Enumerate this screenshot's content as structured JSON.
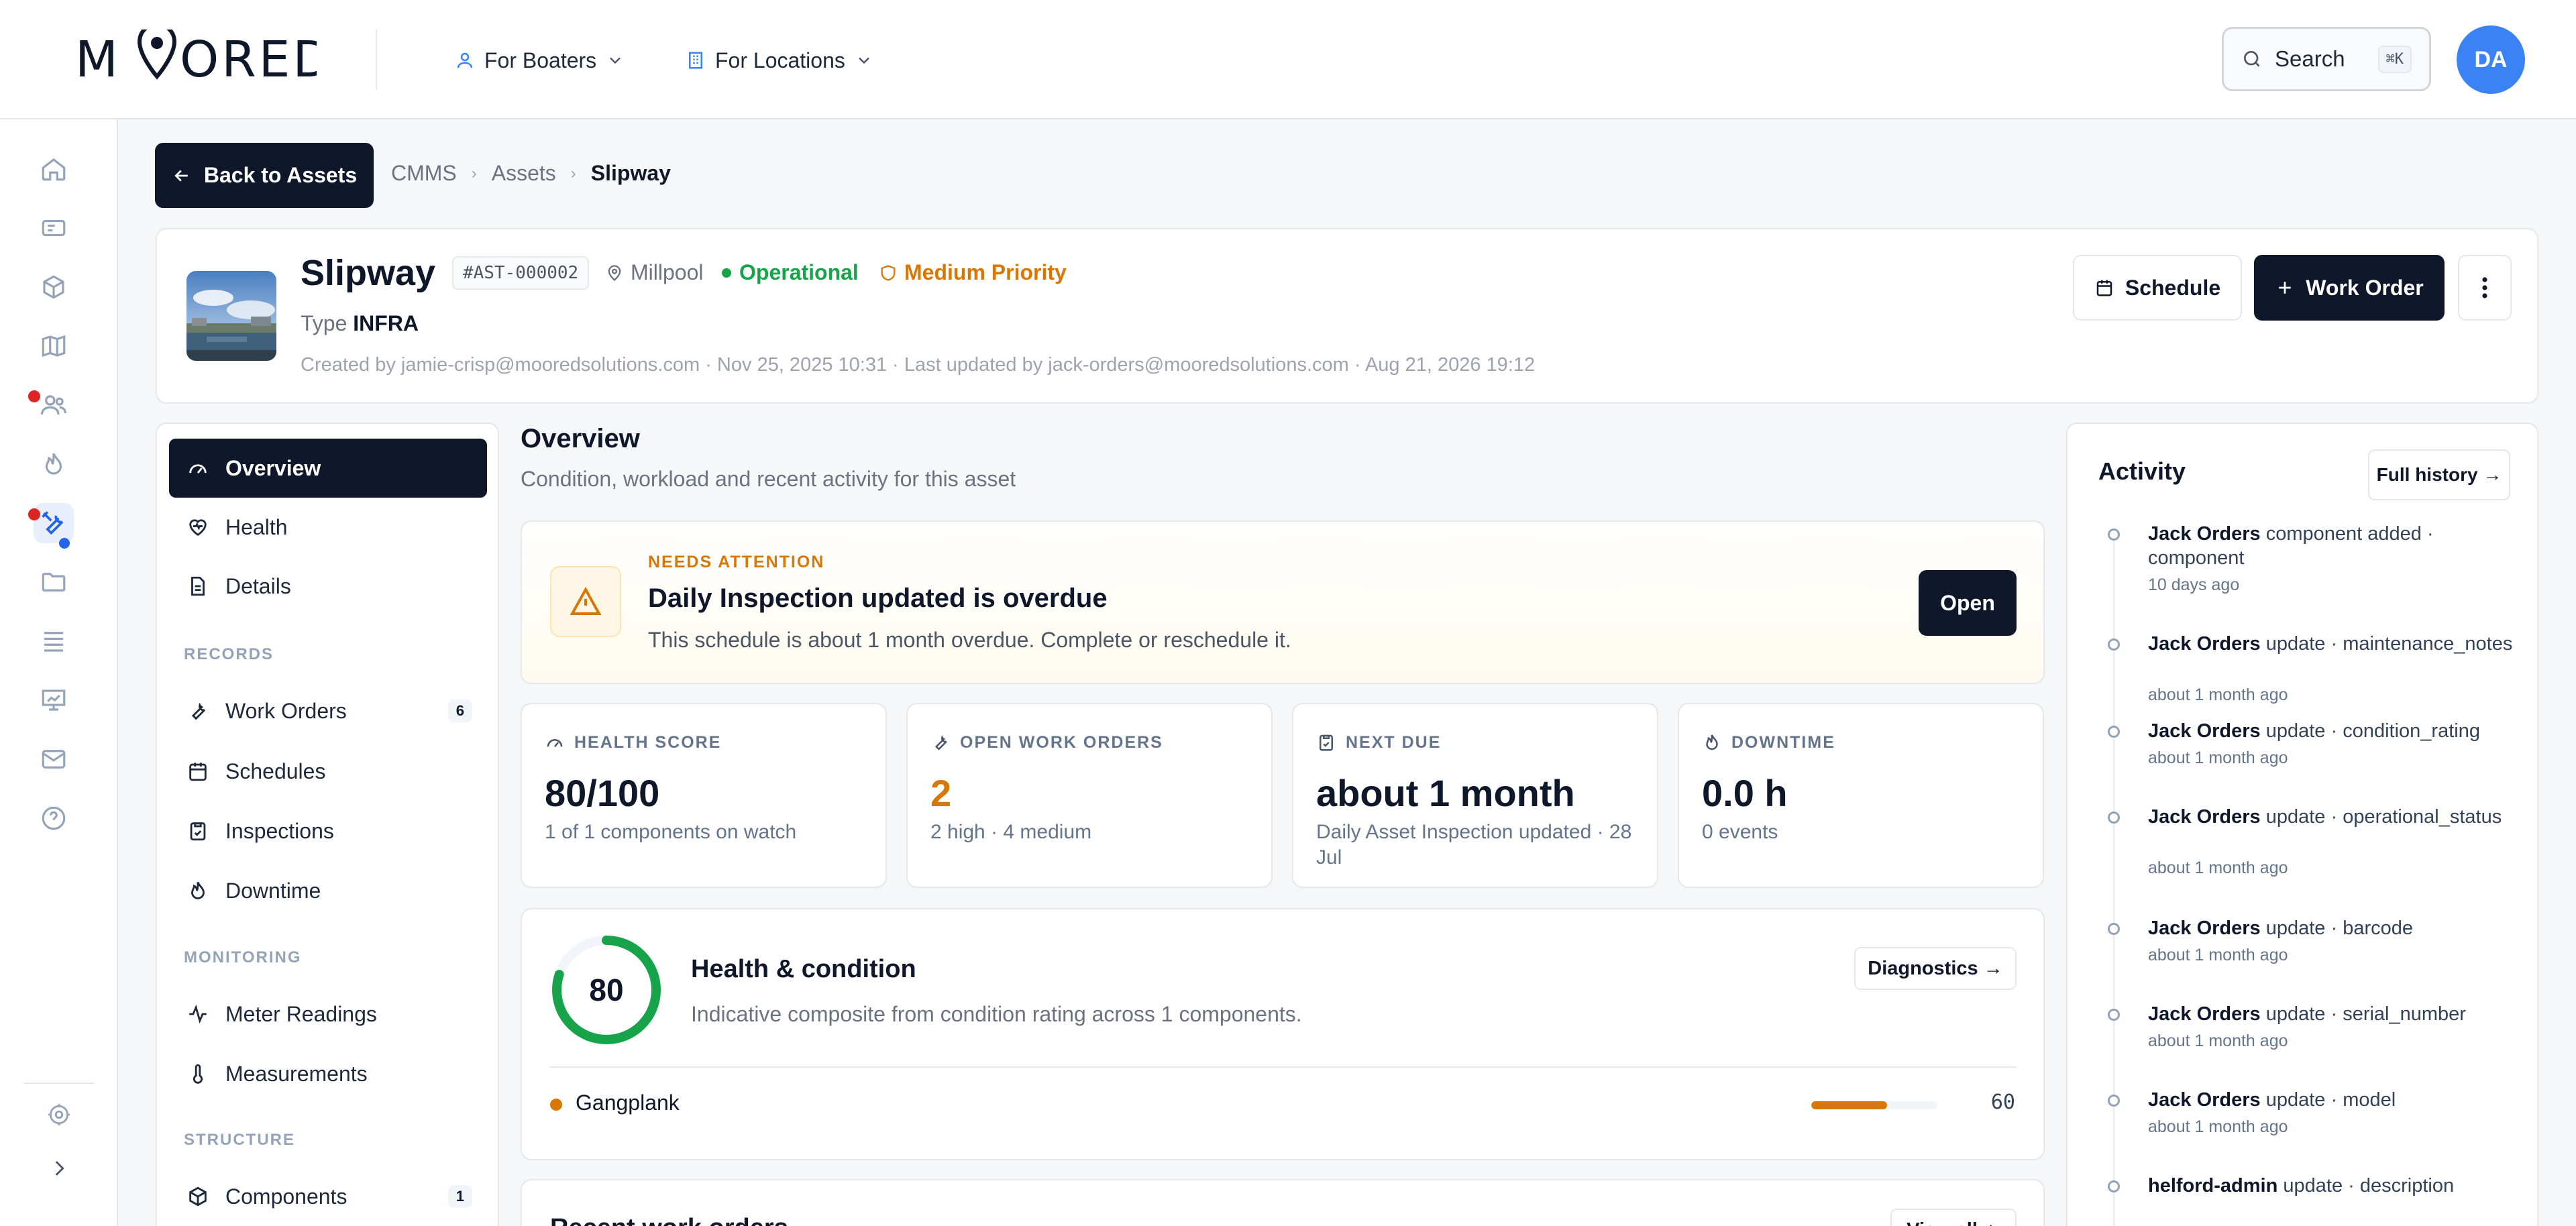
{
  "brand": {
    "logo_text": "MOORED"
  },
  "topnav": {
    "boaters": "For Boaters",
    "locations": "For Locations",
    "search_label": "Search",
    "search_kbd": "⌘K",
    "avatar_initials": "DA"
  },
  "breadcrumb": {
    "back_label": "Back to Assets",
    "items": [
      "CMMS",
      "Assets",
      "Slipway"
    ]
  },
  "asset": {
    "name": "Slipway",
    "id": "#AST-000002",
    "location": "Millpool",
    "status": "Operational",
    "priority": "Medium Priority",
    "type_label": "Type",
    "type_value": "INFRA",
    "meta": "Created by jamie-crisp@mooredsolutions.com · Nov 25, 2025 10:31 · Last updated by jack-orders@mooredsolutions.com · Aug 21, 2026 19:12",
    "schedule_btn": "Schedule",
    "workorder_btn": "Work Order"
  },
  "leftnav": {
    "overview": "Overview",
    "health": "Health",
    "details": "Details",
    "records_head": "RECORDS",
    "work_orders": "Work Orders",
    "work_orders_count": "6",
    "schedules": "Schedules",
    "inspections": "Inspections",
    "downtime": "Downtime",
    "monitoring_head": "MONITORING",
    "meter_readings": "Meter Readings",
    "measurements": "Measurements",
    "structure_head": "STRUCTURE",
    "components": "Components",
    "components_count": "1"
  },
  "overview": {
    "title": "Overview",
    "subtitle": "Condition, workload and recent activity for this asset"
  },
  "alert": {
    "kicker": "NEEDS ATTENTION",
    "title": "Daily Inspection updated is overdue",
    "text": "This schedule is about 1 month overdue. Complete or reschedule it.",
    "button": "Open"
  },
  "kpis": {
    "health": {
      "label": "HEALTH SCORE",
      "value": "80/100",
      "sub": "1 of 1 components on watch"
    },
    "open_wo": {
      "label": "OPEN WORK ORDERS",
      "value": "2",
      "sub": "2 high · 4 medium"
    },
    "next_due": {
      "label": "NEXT DUE",
      "value": "about 1 month",
      "sub": "Daily Asset Inspection updated · 28 Jul"
    },
    "downtime": {
      "label": "DOWNTIME",
      "value": "0.0 h",
      "sub": "0 events"
    }
  },
  "health": {
    "score": "80",
    "score_fraction": 0.8,
    "title": "Health & condition",
    "subtitle": "Indicative composite from condition rating across 1 components.",
    "diag_btn": "Diagnostics →",
    "component_name": "Gangplank",
    "component_value": "60",
    "component_fraction": 0.6
  },
  "recent": {
    "title": "Recent work orders",
    "view_all": "View all"
  },
  "activity": {
    "title": "Activity",
    "full_history": "Full history →",
    "items": [
      {
        "actor": "Jack Orders",
        "action": "component added · component",
        "time": "10 days ago"
      },
      {
        "actor": "Jack Orders",
        "action": "update · maintenance_notes",
        "time": "about 1 month ago"
      },
      {
        "actor": "Jack Orders",
        "action": "update · condition_rating",
        "time": "about 1 month ago"
      },
      {
        "actor": "Jack Orders",
        "action": "update · operational_status",
        "time": "about 1 month ago"
      },
      {
        "actor": "Jack Orders",
        "action": "update · barcode",
        "time": "about 1 month ago"
      },
      {
        "actor": "Jack Orders",
        "action": "update · serial_number",
        "time": "about 1 month ago"
      },
      {
        "actor": "Jack Orders",
        "action": "update · model",
        "time": "about 1 month ago"
      },
      {
        "actor": "helford-admin",
        "action": "update · description",
        "time": ""
      }
    ]
  },
  "colors": {
    "navy": "#0f172a",
    "green": "#16a34a",
    "orange": "#d97706",
    "blue": "#3b82f6",
    "red": "#dc2626"
  }
}
